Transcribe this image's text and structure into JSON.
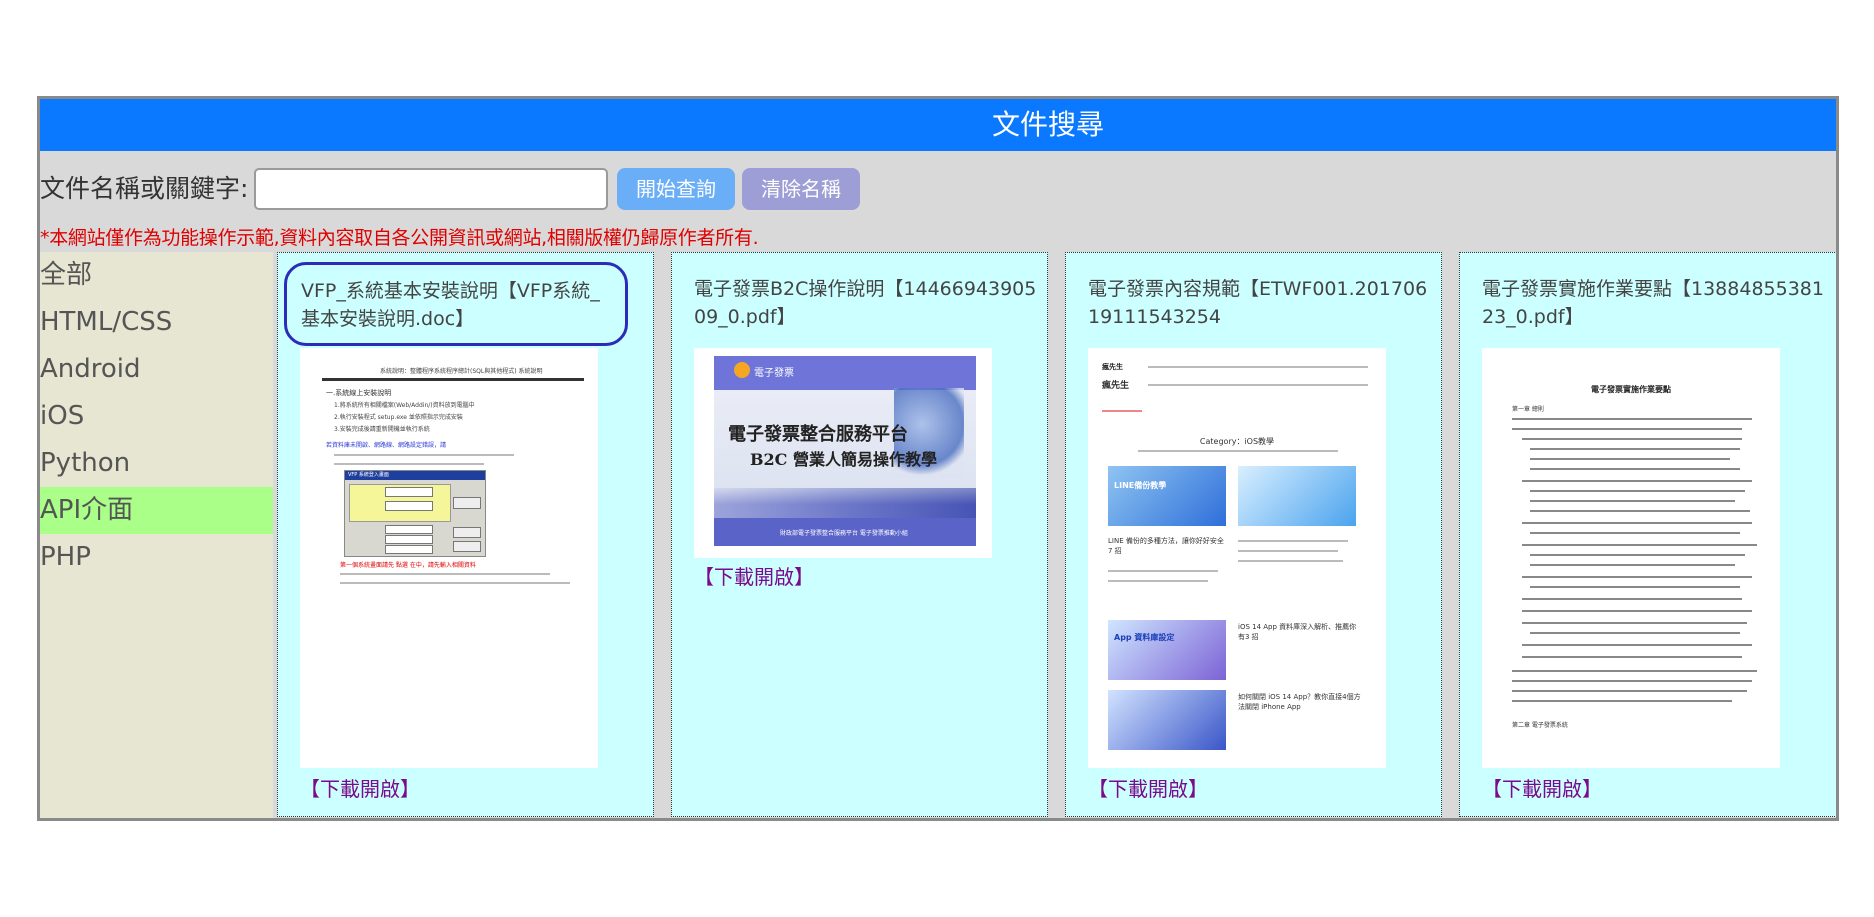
{
  "page": {
    "title": "文件搜尋"
  },
  "search": {
    "label": "文件名稱或關鍵字:",
    "value": "",
    "placeholder": "",
    "search_button": "開始查詢",
    "clear_button": "清除名稱"
  },
  "notice": "*本網站僅作為功能操作示範,資料內容取自各公開資訊或網站,相關版權仍歸原作者所有.",
  "sidebar": {
    "items": [
      {
        "label": "全部",
        "active": false
      },
      {
        "label": "HTML/CSS",
        "active": false
      },
      {
        "label": "Android",
        "active": false
      },
      {
        "label": "iOS",
        "active": false
      },
      {
        "label": "Python",
        "active": false
      },
      {
        "label": "API介面",
        "active": true
      },
      {
        "label": "PHP",
        "active": false
      }
    ]
  },
  "documents": [
    {
      "title": "VFP_系統基本安裝說明【VFP系統_基本安裝說明.doc】",
      "download": "【下載開啟】",
      "thumb_text": {
        "header": "系統說明：整體程序系統程序總計(SQL與其他程式) 系統說明",
        "l1": "一.系統線上安裝說明",
        "l2": "1.將系統所有相關檔案(Web/Addin/)資料放到電腦中",
        "l3": "2.執行安裝程式 setup.exe 並依照指示完成安裝",
        "l4": "3.安裝完成後請重新開機並執行系統",
        "red1": "若資料庫未開啟、網路線、網路設定錯誤，請",
        "red2": "第一個系統畫面請先 點選 在中，請先輸入相關資料",
        "dialog_title": "VFP 系統登入畫面"
      }
    },
    {
      "title": "電子發票B2C操作說明【1446694390509_0.pdf】",
      "download": "【下載開啟】",
      "thumb_text": {
        "logo": "電子發票",
        "line1": "電子發票整合服務平台",
        "line2": "B2C 營業人簡易操作教學",
        "footer": "財政部電子發票整合服務平台 電子發票推動小組"
      }
    },
    {
      "title": "電子發票內容規範【ETWF001.20170619111543254",
      "download": "【下載開啟】",
      "thumb_text": {
        "brand": "瘋先生",
        "category": "Category：iOS教學",
        "card1": "LINE備份教學",
        "card2": "LINE 備份的多種方法，讓你好好安全 7 招",
        "card3": "App 資料庫設定",
        "card4": "iOS 14 App 資料庫深入解析、推薦你有3 招",
        "card5": "如何關閉 iOS 14 App？教你直接4個方法關閉 iPhone App"
      }
    },
    {
      "title": "電子發票實施作業要點【1388485538123_0.pdf】",
      "download": "【下載開啟】",
      "thumb_text": {
        "heading": "電子發票實施作業要點",
        "section1": "第一章 總則",
        "section2": "第二章 電子發票系統"
      }
    }
  ],
  "colors": {
    "titlebar": "#0a78ff",
    "card_bg": "#ccffff",
    "sidebar_bg": "#e6e6d2",
    "active_bg": "#aaff88",
    "notice": "#e00000",
    "download": "#7a0b8a"
  }
}
